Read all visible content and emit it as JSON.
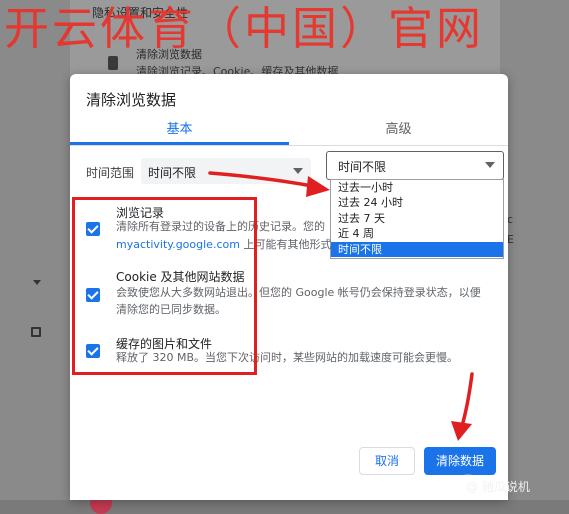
{
  "watermark": "开云体育（中国）官网",
  "background": {
    "heading": "隐私设置和安全性",
    "row_title": "清除浏览数据",
    "row_subtitle": "清除浏览记录、Cookie、缓存及其他数据",
    "right_fragment_1": "c",
    "right_fragment_2": "E"
  },
  "dialog": {
    "title": "清除浏览数据",
    "tabs": [
      {
        "label": "基本",
        "active": true
      },
      {
        "label": "高级",
        "active": false
      }
    ],
    "time_range_label": "时间范围",
    "time_range_value": "时间不限",
    "dropdown": {
      "value": "时间不限",
      "options": [
        {
          "label": "过去一小时",
          "selected": false
        },
        {
          "label": "过去 24 小时",
          "selected": false
        },
        {
          "label": "过去 7 天",
          "selected": false
        },
        {
          "label": "近 4 周",
          "selected": false
        },
        {
          "label": "时间不限",
          "selected": true
        }
      ]
    },
    "items": [
      {
        "title": "浏览记录",
        "desc_line1": "清除所有登录过的设备上的历史记录。您的",
        "link": "myactivity.google.com",
        "desc_line2_suffix": " 上可能有其他形式",
        "checked": true
      },
      {
        "title": "Cookie 及其他网站数据",
        "desc_line1": "会致使您从大多数网站退出。但您的 Google 帐号仍会保持登录状态，以便",
        "desc_line2": "清除您的已同步数据。",
        "checked": true
      },
      {
        "title": "缓存的图片和文件",
        "desc_line1": "释放了 320 MB。当您下次访问时，某些网站的加载速度可能会更慢。",
        "checked": true
      }
    ],
    "cancel_label": "取消",
    "clear_label": "清除数据"
  },
  "credit": "@ 驰瓜说机",
  "colors": {
    "accent": "#1a73e8",
    "annotation_red": "#e02020",
    "watermark_red": "#e8332c"
  }
}
